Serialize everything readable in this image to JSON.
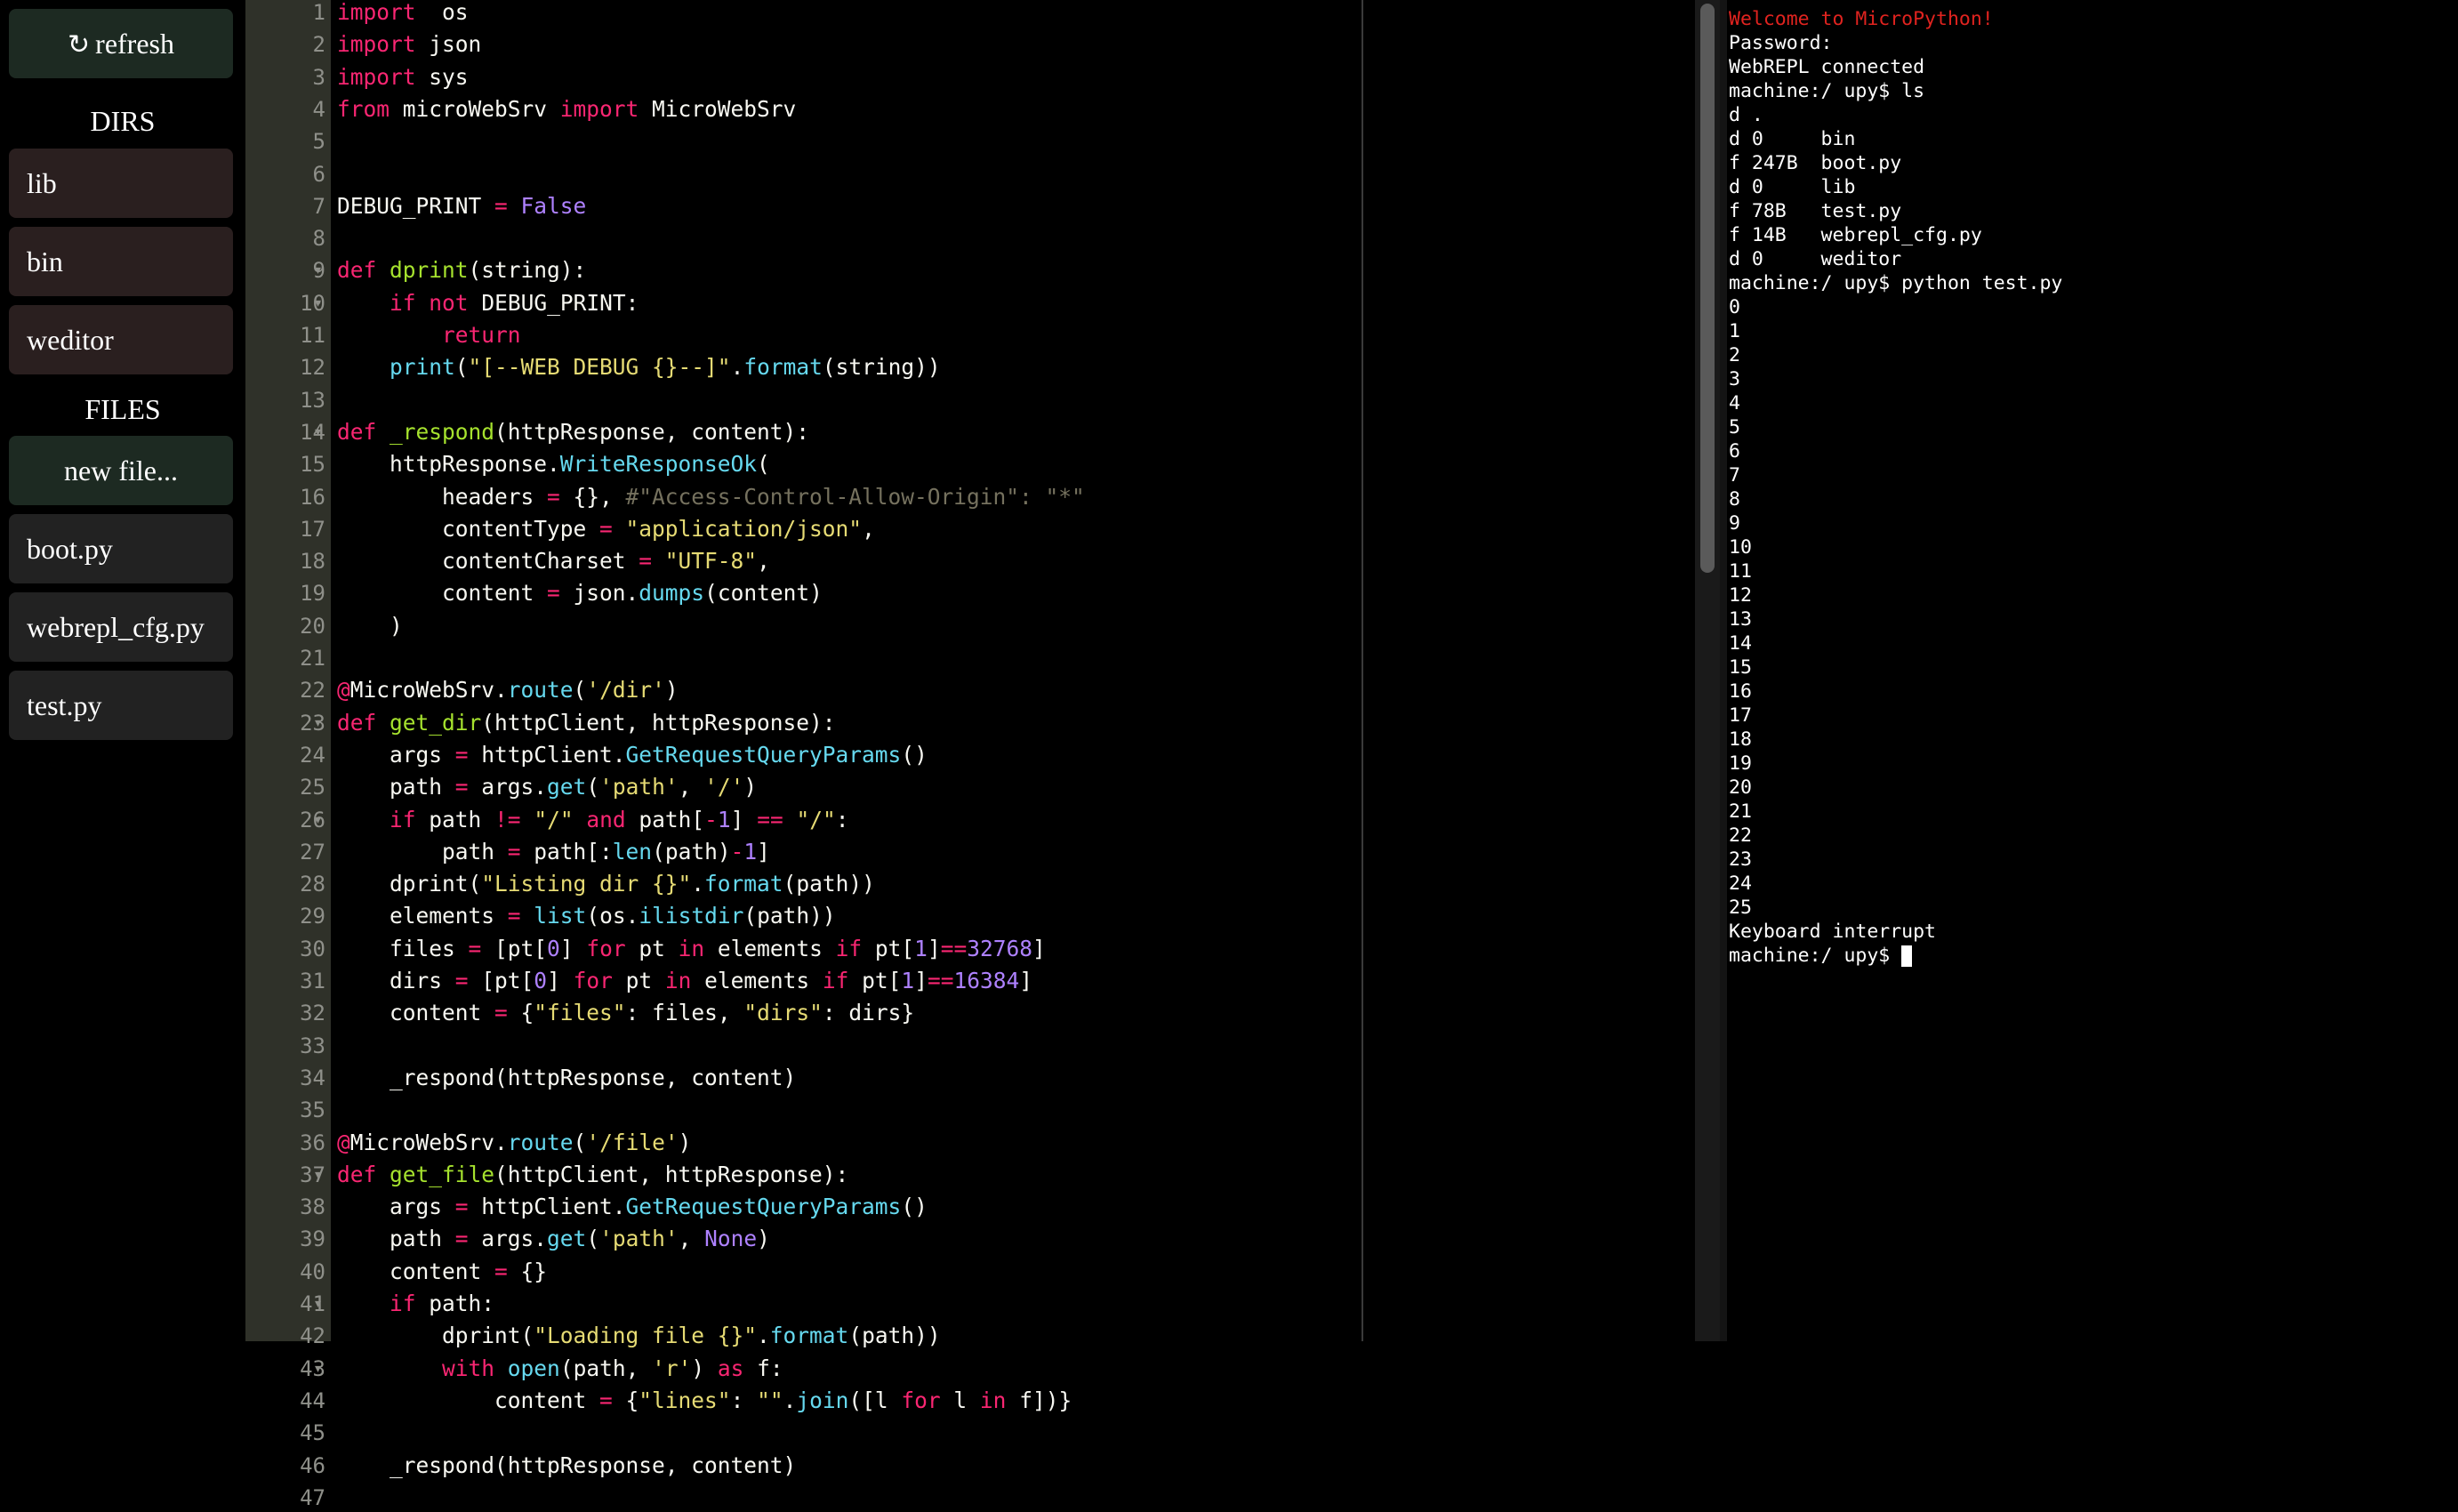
{
  "sidebar": {
    "refresh_label": "refresh",
    "refresh_glyph": "↻",
    "dirs_heading": "DIRS",
    "dirs": [
      "lib",
      "bin",
      "weditor"
    ],
    "files_heading": "FILES",
    "new_file_label": "new file...",
    "files": [
      "boot.py",
      "webrepl_cfg.py",
      "test.py"
    ]
  },
  "editor": {
    "line_numbers": [
      "1",
      "2",
      "3",
      "4",
      "5",
      "6",
      "7",
      "8",
      "9",
      "10",
      "11",
      "12",
      "13",
      "14",
      "15",
      "16",
      "17",
      "18",
      "19",
      "20",
      "21",
      "22",
      "23",
      "24",
      "25",
      "26",
      "27",
      "28",
      "29",
      "30",
      "31",
      "32",
      "33",
      "34",
      "35",
      "36",
      "37",
      "38",
      "39",
      "40",
      "41",
      "42",
      "43",
      "44",
      "45",
      "46",
      "47"
    ],
    "fold_lines": [
      "9",
      "10",
      "14",
      "23",
      "26",
      "37",
      "41",
      "43"
    ],
    "fold_glyph": "▾",
    "lines": [
      [
        [
          "kw",
          "import"
        ],
        [
          "",
          "  os"
        ]
      ],
      [
        [
          "kw",
          "import"
        ],
        [
          "",
          " json"
        ]
      ],
      [
        [
          "kw",
          "import"
        ],
        [
          "",
          " sys"
        ]
      ],
      [
        [
          "kw",
          "from"
        ],
        [
          "",
          " microWebSrv "
        ],
        [
          "kw",
          "import"
        ],
        [
          "",
          " MicroWebSrv"
        ]
      ],
      [],
      [],
      [
        [
          "",
          "DEBUG_PRINT "
        ],
        [
          "op",
          "="
        ],
        [
          " nm",
          " "
        ],
        [
          "nm",
          "False"
        ]
      ],
      [],
      [
        [
          "kw",
          "def"
        ],
        [
          "",
          " "
        ],
        [
          "fn",
          "dprint"
        ],
        [
          "",
          "(string):"
        ]
      ],
      [
        [
          "",
          "    "
        ],
        [
          "kw",
          "if"
        ],
        [
          "",
          " "
        ],
        [
          "kw",
          "not"
        ],
        [
          "",
          " DEBUG_PRINT:"
        ]
      ],
      [
        [
          "",
          "        "
        ],
        [
          "kw",
          "return"
        ]
      ],
      [
        [
          "",
          "    "
        ],
        [
          "bi",
          "print"
        ],
        [
          "",
          "("
        ],
        [
          "st",
          "\"[--WEB DEBUG {}--]\""
        ],
        [
          "",
          "."
        ],
        [
          "bi",
          "format"
        ],
        [
          "",
          "(string))"
        ]
      ],
      [],
      [
        [
          "kw",
          "def"
        ],
        [
          "",
          " "
        ],
        [
          "fn",
          "_respond"
        ],
        [
          "",
          "(httpResponse, content):"
        ]
      ],
      [
        [
          "",
          "    httpResponse."
        ],
        [
          "bi",
          "WriteResponseOk"
        ],
        [
          "",
          "("
        ]
      ],
      [
        [
          "",
          "        headers "
        ],
        [
          "op",
          "="
        ],
        [
          "",
          " {}, "
        ],
        [
          "cm",
          "#\"Access-Control-Allow-Origin\": \"*\""
        ]
      ],
      [
        [
          "",
          "        contentType "
        ],
        [
          "op",
          "="
        ],
        [
          "",
          " "
        ],
        [
          "st",
          "\"application/json\""
        ],
        [
          "",
          ","
        ]
      ],
      [
        [
          "",
          "        contentCharset "
        ],
        [
          "op",
          "="
        ],
        [
          "",
          " "
        ],
        [
          "st",
          "\"UTF-8\""
        ],
        [
          "",
          ","
        ]
      ],
      [
        [
          "",
          "        content "
        ],
        [
          "op",
          "="
        ],
        [
          "",
          " json."
        ],
        [
          "bi",
          "dumps"
        ],
        [
          "",
          "(content)"
        ]
      ],
      [
        [
          "",
          "    )"
        ]
      ],
      [],
      [
        [
          "kw",
          "@"
        ],
        [
          "",
          "MicroWebSrv."
        ],
        [
          "bi",
          "route"
        ],
        [
          "",
          "("
        ],
        [
          "st",
          "'/dir'"
        ],
        [
          "",
          ")"
        ]
      ],
      [
        [
          "kw",
          "def"
        ],
        [
          "",
          " "
        ],
        [
          "fn",
          "get_dir"
        ],
        [
          "",
          "(httpClient, httpResponse):"
        ]
      ],
      [
        [
          "",
          "    args "
        ],
        [
          "op",
          "="
        ],
        [
          "",
          " httpClient."
        ],
        [
          "bi",
          "GetRequestQueryParams"
        ],
        [
          "",
          "()"
        ]
      ],
      [
        [
          "",
          "    path "
        ],
        [
          "op",
          "="
        ],
        [
          "",
          " args."
        ],
        [
          "bi",
          "get"
        ],
        [
          "",
          "("
        ],
        [
          "st",
          "'path'"
        ],
        [
          "",
          ", "
        ],
        [
          "st",
          "'/'"
        ],
        [
          "",
          ")"
        ]
      ],
      [
        [
          "",
          "    "
        ],
        [
          "kw",
          "if"
        ],
        [
          "",
          " path "
        ],
        [
          "op",
          "!="
        ],
        [
          "",
          " "
        ],
        [
          "st",
          "\"/\""
        ],
        [
          "",
          " "
        ],
        [
          "kw",
          "and"
        ],
        [
          "",
          " path["
        ],
        [
          "op",
          "-"
        ],
        [
          "nm",
          "1"
        ],
        [
          "",
          "] "
        ],
        [
          "op",
          "=="
        ],
        [
          "",
          " "
        ],
        [
          "st",
          "\"/\""
        ],
        [
          "",
          ":"
        ]
      ],
      [
        [
          "",
          "        path "
        ],
        [
          "op",
          "="
        ],
        [
          "",
          " path[:"
        ],
        [
          "bi",
          "len"
        ],
        [
          "",
          "(path)"
        ],
        [
          "op",
          "-"
        ],
        [
          "nm",
          "1"
        ],
        [
          "",
          "]"
        ]
      ],
      [
        [
          "",
          "    dprint("
        ],
        [
          "st",
          "\"Listing dir {}\""
        ],
        [
          "",
          "."
        ],
        [
          "bi",
          "format"
        ],
        [
          "",
          "(path))"
        ]
      ],
      [
        [
          "",
          "    elements "
        ],
        [
          "op",
          "="
        ],
        [
          "",
          " "
        ],
        [
          "bi",
          "list"
        ],
        [
          "",
          "(os."
        ],
        [
          "bi",
          "ilistdir"
        ],
        [
          "",
          "(path))"
        ]
      ],
      [
        [
          "",
          "    files "
        ],
        [
          "op",
          "="
        ],
        [
          "",
          " [pt["
        ],
        [
          "nm",
          "0"
        ],
        [
          "",
          "] "
        ],
        [
          "kw",
          "for"
        ],
        [
          "",
          " pt "
        ],
        [
          "kw",
          "in"
        ],
        [
          "",
          " elements "
        ],
        [
          "kw",
          "if"
        ],
        [
          "",
          " pt["
        ],
        [
          "nm",
          "1"
        ],
        [
          "",
          "]"
        ],
        [
          "op",
          "=="
        ],
        [
          "nm",
          "32768"
        ],
        [
          "",
          "]"
        ]
      ],
      [
        [
          "",
          "    dirs "
        ],
        [
          "op",
          "="
        ],
        [
          "",
          " [pt["
        ],
        [
          "nm",
          "0"
        ],
        [
          "",
          "] "
        ],
        [
          "kw",
          "for"
        ],
        [
          "",
          " pt "
        ],
        [
          "kw",
          "in"
        ],
        [
          "",
          " elements "
        ],
        [
          "kw",
          "if"
        ],
        [
          "",
          " pt["
        ],
        [
          "nm",
          "1"
        ],
        [
          "",
          "]"
        ],
        [
          "op",
          "=="
        ],
        [
          "nm",
          "16384"
        ],
        [
          "",
          "]"
        ]
      ],
      [
        [
          "",
          "    content "
        ],
        [
          "op",
          "="
        ],
        [
          "",
          " {"
        ],
        [
          "st",
          "\"files\""
        ],
        [
          "",
          ": files, "
        ],
        [
          "st",
          "\"dirs\""
        ],
        [
          "",
          ": dirs}"
        ]
      ],
      [],
      [
        [
          "",
          "    _respond(httpResponse, content)"
        ]
      ],
      [],
      [
        [
          "kw",
          "@"
        ],
        [
          "",
          "MicroWebSrv."
        ],
        [
          "bi",
          "route"
        ],
        [
          "",
          "("
        ],
        [
          "st",
          "'/file'"
        ],
        [
          "",
          ")"
        ]
      ],
      [
        [
          "kw",
          "def"
        ],
        [
          "",
          " "
        ],
        [
          "fn",
          "get_file"
        ],
        [
          "",
          "(httpClient, httpResponse):"
        ]
      ],
      [
        [
          "",
          "    args "
        ],
        [
          "op",
          "="
        ],
        [
          "",
          " httpClient."
        ],
        [
          "bi",
          "GetRequestQueryParams"
        ],
        [
          "",
          "()"
        ]
      ],
      [
        [
          "",
          "    path "
        ],
        [
          "op",
          "="
        ],
        [
          "",
          " args."
        ],
        [
          "bi",
          "get"
        ],
        [
          "",
          "("
        ],
        [
          "st",
          "'path'"
        ],
        [
          "",
          ", "
        ],
        [
          "nm",
          "None"
        ],
        [
          "",
          ")"
        ]
      ],
      [
        [
          "",
          "    content "
        ],
        [
          "op",
          "="
        ],
        [
          "",
          " {}"
        ]
      ],
      [
        [
          "",
          "    "
        ],
        [
          "kw",
          "if"
        ],
        [
          "",
          " path:"
        ]
      ],
      [
        [
          "",
          "        dprint("
        ],
        [
          "st",
          "\"Loading file {}\""
        ],
        [
          "",
          "."
        ],
        [
          "bi",
          "format"
        ],
        [
          "",
          "(path))"
        ]
      ],
      [
        [
          "",
          "        "
        ],
        [
          "kw",
          "with"
        ],
        [
          "",
          " "
        ],
        [
          "bi",
          "open"
        ],
        [
          "",
          "(path, "
        ],
        [
          "st",
          "'r'"
        ],
        [
          "",
          ") "
        ],
        [
          "kw",
          "as"
        ],
        [
          "",
          " f:"
        ]
      ],
      [
        [
          "",
          "            content "
        ],
        [
          "op",
          "="
        ],
        [
          "",
          " {"
        ],
        [
          "st",
          "\"lines\""
        ],
        [
          "",
          ": "
        ],
        [
          "st",
          "\"\""
        ],
        [
          "",
          "."
        ],
        [
          "bi",
          "join"
        ],
        [
          "",
          "([l "
        ],
        [
          "kw",
          "for"
        ],
        [
          "",
          " l "
        ],
        [
          "kw",
          "in"
        ],
        [
          "",
          " f])}"
        ]
      ],
      [],
      [
        [
          "",
          "    _respond(httpResponse, content)"
        ]
      ],
      []
    ]
  },
  "terminal": {
    "lines": [
      {
        "text": "Welcome to MicroPython!",
        "color": "#e0231f"
      },
      {
        "text": "Password:"
      },
      {
        "text": "WebREPL connected"
      },
      {
        "text": "machine:/ upy$ ls"
      },
      {
        "text": "d ."
      },
      {
        "text": "d 0     bin"
      },
      {
        "text": "f 247B  boot.py"
      },
      {
        "text": "d 0     lib"
      },
      {
        "text": "f 78B   test.py"
      },
      {
        "text": "f 14B   webrepl_cfg.py"
      },
      {
        "text": "d 0     weditor"
      },
      {
        "text": "machine:/ upy$ python test.py"
      },
      {
        "text": "0"
      },
      {
        "text": "1"
      },
      {
        "text": "2"
      },
      {
        "text": "3"
      },
      {
        "text": "4"
      },
      {
        "text": "5"
      },
      {
        "text": "6"
      },
      {
        "text": "7"
      },
      {
        "text": "8"
      },
      {
        "text": "9"
      },
      {
        "text": "10"
      },
      {
        "text": "11"
      },
      {
        "text": "12"
      },
      {
        "text": "13"
      },
      {
        "text": "14"
      },
      {
        "text": "15"
      },
      {
        "text": "16"
      },
      {
        "text": "17"
      },
      {
        "text": "18"
      },
      {
        "text": "19"
      },
      {
        "text": "20"
      },
      {
        "text": "21"
      },
      {
        "text": "22"
      },
      {
        "text": "23"
      },
      {
        "text": "24"
      },
      {
        "text": "25"
      },
      {
        "text": "Keyboard interrupt"
      }
    ],
    "prompt": "machine:/ upy$ "
  },
  "colors": {
    "background": "#000000",
    "gutter": "#2f3129",
    "sidebar_green_button": "#1d2a22",
    "sidebar_dir_item": "#2a1f1f",
    "sidebar_file_item": "#222222",
    "terminal_welcome": "#e0231f"
  }
}
